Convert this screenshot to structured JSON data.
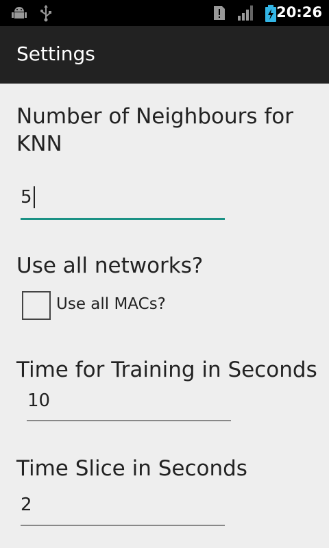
{
  "status_bar": {
    "time": "20:26",
    "icons": [
      "android-debug-icon",
      "usb-icon",
      "alert-card-icon",
      "signal-icon",
      "battery-charging-icon"
    ]
  },
  "action_bar": {
    "title": "Settings"
  },
  "settings": {
    "knn_heading": "Number of Neighbours for KNN",
    "knn_value": "5",
    "networks_heading": "Use all networks?",
    "use_all_macs_label": "Use all MACs?",
    "use_all_macs_checked": false,
    "training_heading": "Time for Training in Seconds",
    "training_value": "10",
    "slice_heading": "Time Slice in Seconds",
    "slice_value": "2"
  },
  "colors": {
    "accent": "#1a9184",
    "action_bar": "#222222",
    "status_bar": "#000000",
    "background": "#eeeeee"
  }
}
